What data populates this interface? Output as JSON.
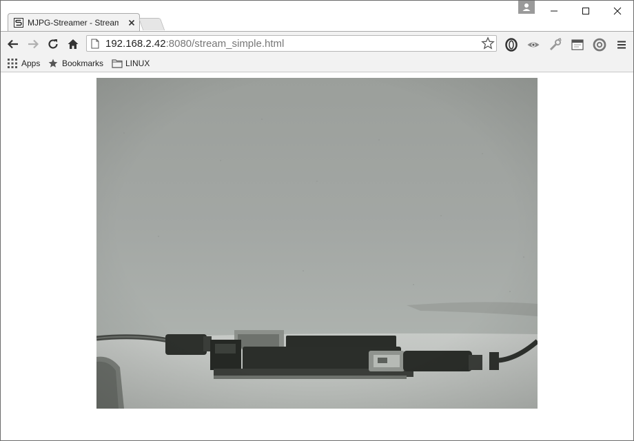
{
  "browser": {
    "tab": {
      "title": "MJPG-Streamer - Stream E"
    },
    "url": {
      "host": "192.168.2.42",
      "rest": ":8080/stream_simple.html"
    }
  },
  "bookmarks": {
    "items": [
      {
        "label": "Apps",
        "icon": "apps-grid-icon"
      },
      {
        "label": "Bookmarks",
        "icon": "star-icon"
      },
      {
        "label": "LINUX",
        "icon": "folder-icon"
      }
    ]
  },
  "stream": {
    "description_icon": "camera-stream-image"
  },
  "colors": {
    "chrome_bg": "#f2f2f2",
    "border": "#a9a9a9",
    "text": "#222222",
    "url_dim": "#777777"
  }
}
